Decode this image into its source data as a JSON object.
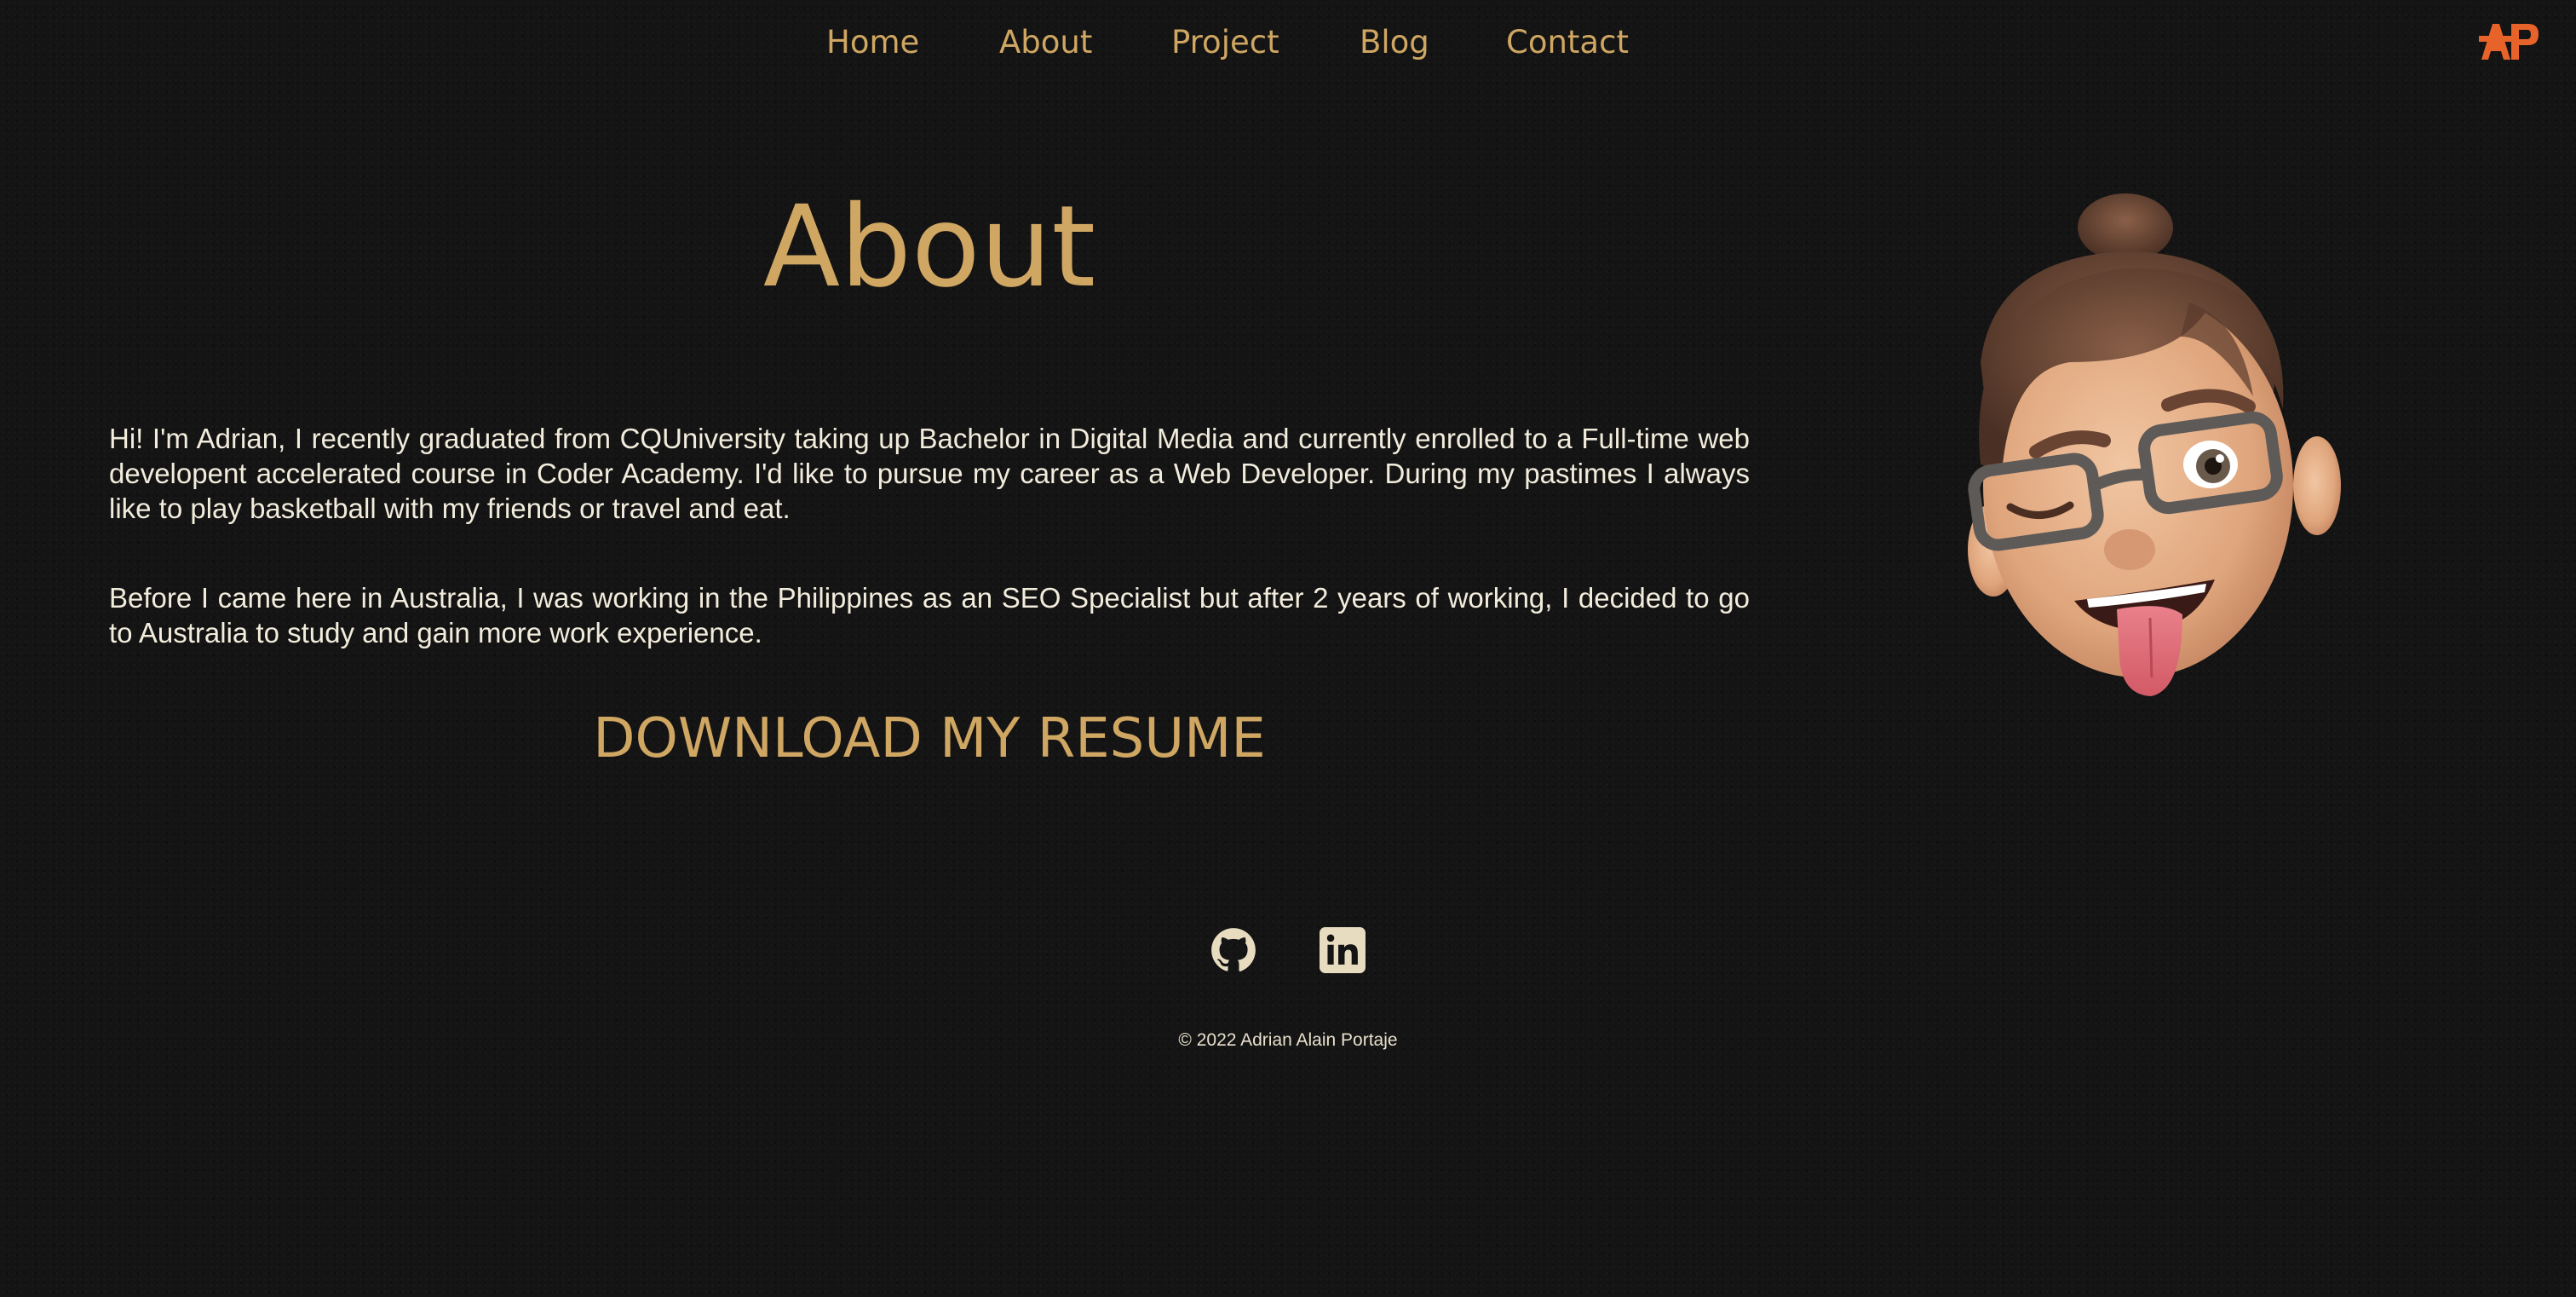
{
  "nav": {
    "items": [
      {
        "label": "Home"
      },
      {
        "label": "About"
      },
      {
        "label": "Project"
      },
      {
        "label": "Blog"
      },
      {
        "label": "Contact"
      }
    ],
    "logo_text": "AP",
    "logo_color": "#e8632a"
  },
  "main": {
    "title": "About",
    "paragraphs": [
      "Hi! I'm Adrian, I recently graduated from CQUniversity taking up Bachelor in Digital Media and currently enrolled to a Full-time web developent accelerated course in Coder Academy. I'd like to pursue my career as a Web Developer. During my pastimes I always like to play basketball with my friends or travel and eat.",
      "Before I came here in Australia, I was working in the Philippines as an SEO Specialist but after 2 years of working, I decided to go to Australia to study and gain more work experience."
    ],
    "resume_label": "DOWNLOAD MY RESUME",
    "avatar_icon": "memoji-avatar"
  },
  "footer": {
    "social": [
      {
        "icon": "github-icon"
      },
      {
        "icon": "linkedin-icon"
      }
    ],
    "copyright": "© 2022 Adrian Alain Portaje"
  },
  "colors": {
    "background": "#141414",
    "accent": "#cfa662",
    "text": "#f2ecdc",
    "icon": "#e8dcc0"
  }
}
